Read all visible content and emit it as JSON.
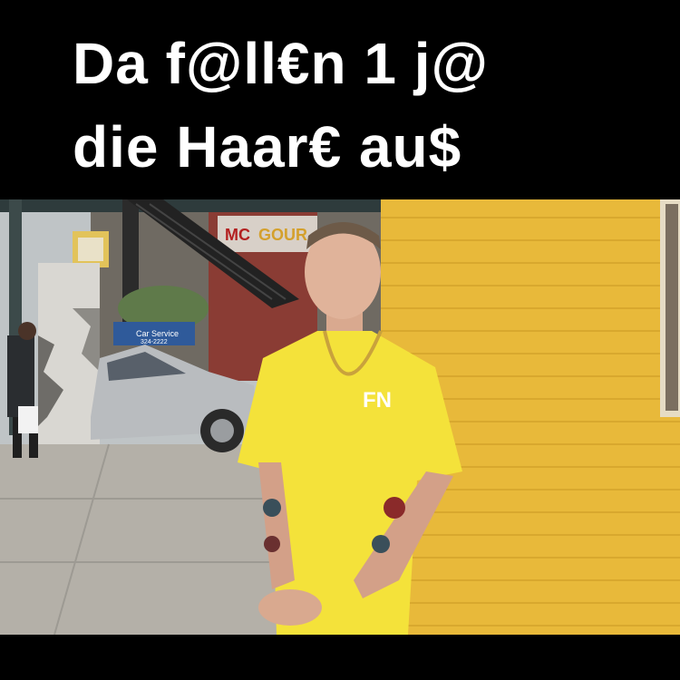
{
  "meme": {
    "caption_line_1": "Da f@ll€n 1 j@",
    "caption_line_2": "die Haar€ au$",
    "colors": {
      "background": "#000000",
      "caption_text": "#ffffff",
      "wall_yellow": "#e8b93a",
      "shirt_yellow": "#f4e23a"
    }
  },
  "photo": {
    "description_icon": "photo-street-portrait",
    "sign_texts": [
      "Car Service",
      "324-2222"
    ],
    "shirt_logo": "FN"
  }
}
